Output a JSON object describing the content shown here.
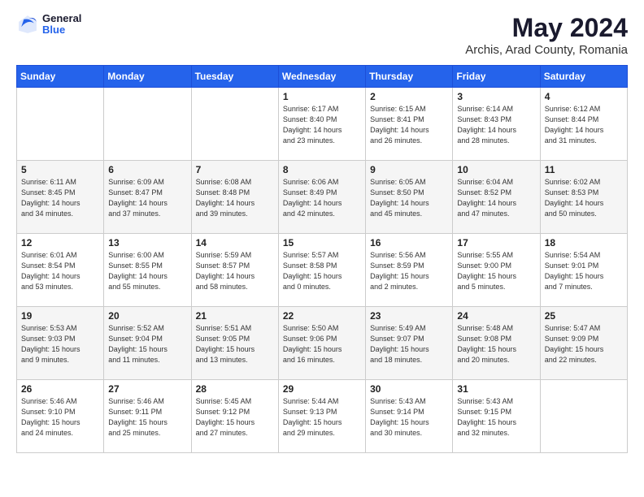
{
  "header": {
    "logo": {
      "general": "General",
      "blue": "Blue"
    },
    "title": "May 2024",
    "location": "Archis, Arad County, Romania"
  },
  "weekdays": [
    "Sunday",
    "Monday",
    "Tuesday",
    "Wednesday",
    "Thursday",
    "Friday",
    "Saturday"
  ],
  "weeks": [
    [
      {
        "day": "",
        "info": ""
      },
      {
        "day": "",
        "info": ""
      },
      {
        "day": "",
        "info": ""
      },
      {
        "day": "1",
        "info": "Sunrise: 6:17 AM\nSunset: 8:40 PM\nDaylight: 14 hours\nand 23 minutes."
      },
      {
        "day": "2",
        "info": "Sunrise: 6:15 AM\nSunset: 8:41 PM\nDaylight: 14 hours\nand 26 minutes."
      },
      {
        "day": "3",
        "info": "Sunrise: 6:14 AM\nSunset: 8:43 PM\nDaylight: 14 hours\nand 28 minutes."
      },
      {
        "day": "4",
        "info": "Sunrise: 6:12 AM\nSunset: 8:44 PM\nDaylight: 14 hours\nand 31 minutes."
      }
    ],
    [
      {
        "day": "5",
        "info": "Sunrise: 6:11 AM\nSunset: 8:45 PM\nDaylight: 14 hours\nand 34 minutes."
      },
      {
        "day": "6",
        "info": "Sunrise: 6:09 AM\nSunset: 8:47 PM\nDaylight: 14 hours\nand 37 minutes."
      },
      {
        "day": "7",
        "info": "Sunrise: 6:08 AM\nSunset: 8:48 PM\nDaylight: 14 hours\nand 39 minutes."
      },
      {
        "day": "8",
        "info": "Sunrise: 6:06 AM\nSunset: 8:49 PM\nDaylight: 14 hours\nand 42 minutes."
      },
      {
        "day": "9",
        "info": "Sunrise: 6:05 AM\nSunset: 8:50 PM\nDaylight: 14 hours\nand 45 minutes."
      },
      {
        "day": "10",
        "info": "Sunrise: 6:04 AM\nSunset: 8:52 PM\nDaylight: 14 hours\nand 47 minutes."
      },
      {
        "day": "11",
        "info": "Sunrise: 6:02 AM\nSunset: 8:53 PM\nDaylight: 14 hours\nand 50 minutes."
      }
    ],
    [
      {
        "day": "12",
        "info": "Sunrise: 6:01 AM\nSunset: 8:54 PM\nDaylight: 14 hours\nand 53 minutes."
      },
      {
        "day": "13",
        "info": "Sunrise: 6:00 AM\nSunset: 8:55 PM\nDaylight: 14 hours\nand 55 minutes."
      },
      {
        "day": "14",
        "info": "Sunrise: 5:59 AM\nSunset: 8:57 PM\nDaylight: 14 hours\nand 58 minutes."
      },
      {
        "day": "15",
        "info": "Sunrise: 5:57 AM\nSunset: 8:58 PM\nDaylight: 15 hours\nand 0 minutes."
      },
      {
        "day": "16",
        "info": "Sunrise: 5:56 AM\nSunset: 8:59 PM\nDaylight: 15 hours\nand 2 minutes."
      },
      {
        "day": "17",
        "info": "Sunrise: 5:55 AM\nSunset: 9:00 PM\nDaylight: 15 hours\nand 5 minutes."
      },
      {
        "day": "18",
        "info": "Sunrise: 5:54 AM\nSunset: 9:01 PM\nDaylight: 15 hours\nand 7 minutes."
      }
    ],
    [
      {
        "day": "19",
        "info": "Sunrise: 5:53 AM\nSunset: 9:03 PM\nDaylight: 15 hours\nand 9 minutes."
      },
      {
        "day": "20",
        "info": "Sunrise: 5:52 AM\nSunset: 9:04 PM\nDaylight: 15 hours\nand 11 minutes."
      },
      {
        "day": "21",
        "info": "Sunrise: 5:51 AM\nSunset: 9:05 PM\nDaylight: 15 hours\nand 13 minutes."
      },
      {
        "day": "22",
        "info": "Sunrise: 5:50 AM\nSunset: 9:06 PM\nDaylight: 15 hours\nand 16 minutes."
      },
      {
        "day": "23",
        "info": "Sunrise: 5:49 AM\nSunset: 9:07 PM\nDaylight: 15 hours\nand 18 minutes."
      },
      {
        "day": "24",
        "info": "Sunrise: 5:48 AM\nSunset: 9:08 PM\nDaylight: 15 hours\nand 20 minutes."
      },
      {
        "day": "25",
        "info": "Sunrise: 5:47 AM\nSunset: 9:09 PM\nDaylight: 15 hours\nand 22 minutes."
      }
    ],
    [
      {
        "day": "26",
        "info": "Sunrise: 5:46 AM\nSunset: 9:10 PM\nDaylight: 15 hours\nand 24 minutes."
      },
      {
        "day": "27",
        "info": "Sunrise: 5:46 AM\nSunset: 9:11 PM\nDaylight: 15 hours\nand 25 minutes."
      },
      {
        "day": "28",
        "info": "Sunrise: 5:45 AM\nSunset: 9:12 PM\nDaylight: 15 hours\nand 27 minutes."
      },
      {
        "day": "29",
        "info": "Sunrise: 5:44 AM\nSunset: 9:13 PM\nDaylight: 15 hours\nand 29 minutes."
      },
      {
        "day": "30",
        "info": "Sunrise: 5:43 AM\nSunset: 9:14 PM\nDaylight: 15 hours\nand 30 minutes."
      },
      {
        "day": "31",
        "info": "Sunrise: 5:43 AM\nSunset: 9:15 PM\nDaylight: 15 hours\nand 32 minutes."
      },
      {
        "day": "",
        "info": ""
      }
    ]
  ]
}
